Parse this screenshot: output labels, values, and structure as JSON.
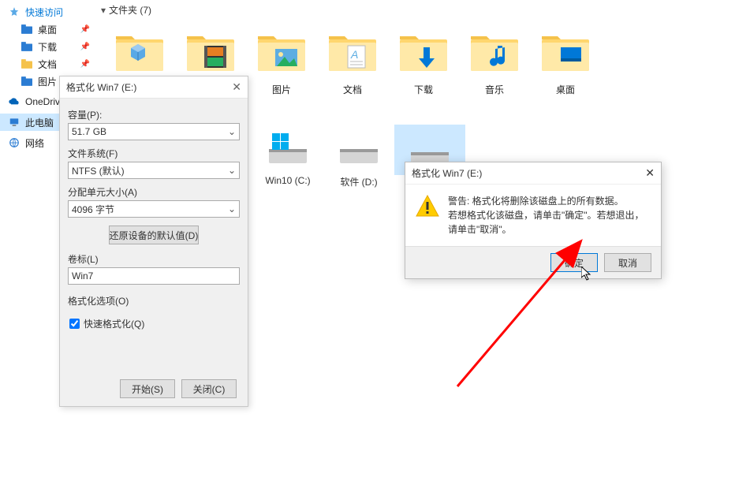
{
  "sidebar": {
    "quick_access": "快速访问",
    "items": [
      {
        "label": "桌面",
        "type": "folder-blue"
      },
      {
        "label": "下载",
        "type": "folder-blue"
      },
      {
        "label": "文档",
        "type": "folder-yellow"
      },
      {
        "label": "图片",
        "type": "folder-blue"
      }
    ],
    "onedrive": "OneDrive",
    "this_pc": "此电脑",
    "network": "网络"
  },
  "header": {
    "section": "文件夹 (7)",
    "chevron": "▾"
  },
  "folders": [
    {
      "label": "",
      "overlay": "3d"
    },
    {
      "label": "",
      "overlay": "video"
    },
    {
      "label": "图片",
      "overlay": "picture"
    },
    {
      "label": "文档",
      "overlay": "document"
    },
    {
      "label": "下载",
      "overlay": "download"
    },
    {
      "label": "音乐",
      "overlay": "music"
    },
    {
      "label": "桌面",
      "overlay": "desktop"
    }
  ],
  "drives": [
    {
      "label": "Win10 (C:)",
      "overlay": "windows"
    },
    {
      "label": "软件 (D:)",
      "overlay": "none"
    },
    {
      "label": "",
      "overlay": "none",
      "selected": true
    }
  ],
  "format": {
    "title": "格式化 Win7 (E:)",
    "capacity_label": "容量(P):",
    "capacity_value": "51.7 GB",
    "fs_label": "文件系统(F)",
    "fs_value": "NTFS (默认)",
    "alloc_label": "分配单元大小(A)",
    "alloc_value": "4096 字节",
    "restore_btn": "还原设备的默认值(D)",
    "volume_label": "卷标(L)",
    "volume_value": "Win7",
    "options_label": "格式化选项(O)",
    "quick_format": "快速格式化(Q)",
    "start_btn": "开始(S)",
    "close_btn": "关闭(C)"
  },
  "confirm": {
    "title": "格式化 Win7 (E:)",
    "line1": "警告: 格式化将删除该磁盘上的所有数据。",
    "line2": "若想格式化该磁盘，请单击\"确定\"。若想退出，请单击\"取消\"。",
    "ok": "确定",
    "cancel": "取消"
  }
}
